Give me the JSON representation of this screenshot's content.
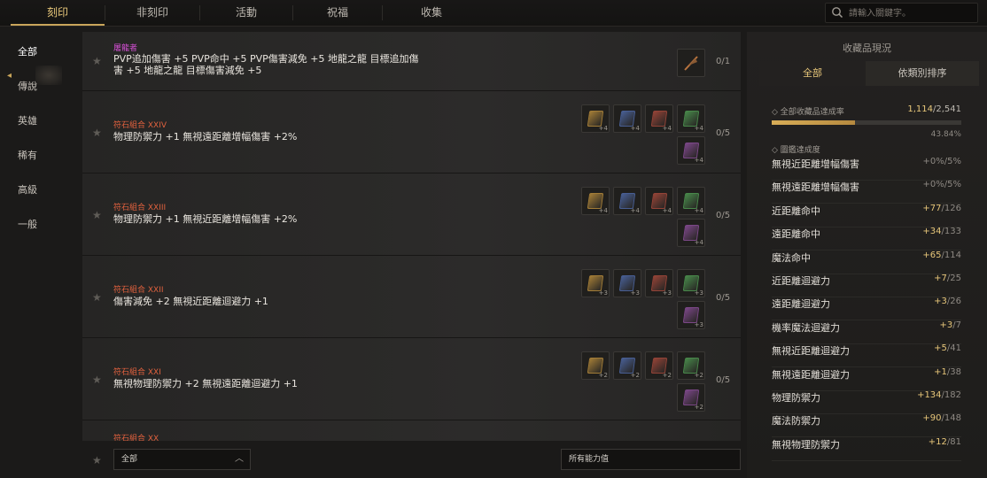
{
  "top_tabs": [
    "刻印",
    "非刻印",
    "活動",
    "祝福",
    "收集"
  ],
  "search": {
    "placeholder": "請輸入關鍵字。"
  },
  "left_nav": [
    "全部",
    "傳說",
    "英雄",
    "稀有",
    "高級",
    "一般"
  ],
  "rows": [
    {
      "category": "屠龍者",
      "desc1": "PVP追加傷害 +5 PVP命中 +5 PVP傷害減免 +5 地龍之龍 目標追加傷",
      "desc2": "害 +5 地龍之龍 目標傷害減免 +5",
      "count": "0/1"
    },
    {
      "category": "符石組合 XXIV",
      "desc1": "物理防禦力 +1 無視遠距離增幅傷害 +2%",
      "count": "0/5",
      "plus": [
        "+4",
        "+4",
        "+4",
        "+4",
        "+4"
      ]
    },
    {
      "category": "符石組合 XXIII",
      "desc1": "物理防禦力 +1 無視近距離增幅傷害 +2%",
      "count": "0/5",
      "plus": [
        "+4",
        "+4",
        "+4",
        "+4",
        "+4"
      ]
    },
    {
      "category": "符石組合 XXII",
      "desc1": "傷害減免 +2 無視近距離迴避力 +1",
      "count": "0/5",
      "plus": [
        "+3",
        "+3",
        "+3",
        "+3",
        "+3"
      ]
    },
    {
      "category": "符石組合 XXI",
      "desc1": "無視物理防禦力 +2 無視遠距離迴避力 +1",
      "count": "0/5",
      "plus": [
        "+2",
        "+2",
        "+2",
        "+2",
        "+2"
      ]
    },
    {
      "category": "符石組合 XX"
    }
  ],
  "bottom": {
    "filter_left": "全部",
    "filter_right": "所有能力值"
  },
  "panel": {
    "title": "收藏品現況",
    "tabs": [
      "全部",
      "依類別排序"
    ],
    "rate_label": "◇ 全部收藏品達成率",
    "rate_current": "1,114",
    "rate_total": "/2,541",
    "rate_fraction": 0.4384,
    "rate_pct": "43.84%",
    "stat_header": "◇ 圖鑑達成度",
    "stats": [
      {
        "name": "無視近距離增幅傷害",
        "current": "+0%",
        "total": "/5%"
      },
      {
        "name": "無視遠距離增幅傷害",
        "current": "+0%",
        "total": "/5%"
      },
      {
        "name": "近距離命中",
        "current": "+77",
        "total": "/126"
      },
      {
        "name": "遠距離命中",
        "current": "+34",
        "total": "/133"
      },
      {
        "name": "魔法命中",
        "current": "+65",
        "total": "/114"
      },
      {
        "name": "近距離迴避力",
        "current": "+7",
        "total": "/25"
      },
      {
        "name": "遠距離迴避力",
        "current": "+3",
        "total": "/26"
      },
      {
        "name": "機率魔法迴避力",
        "current": "+3",
        "total": "/7"
      },
      {
        "name": "無視近距離迴避力",
        "current": "+5",
        "total": "/41"
      },
      {
        "name": "無視遠距離迴避力",
        "current": "+1",
        "total": "/38"
      },
      {
        "name": "物理防禦力",
        "current": "+134",
        "total": "/182"
      },
      {
        "name": "魔法防禦力",
        "current": "+90",
        "total": "/148"
      },
      {
        "name": "無視物理防禦力",
        "current": "+12",
        "total": "/81"
      }
    ]
  },
  "gem_colors": [
    "#b98d3c",
    "#4f6aa8",
    "#a84a3c",
    "#4f9a52",
    "#8b4e9a"
  ],
  "accent": "#c9a55a"
}
